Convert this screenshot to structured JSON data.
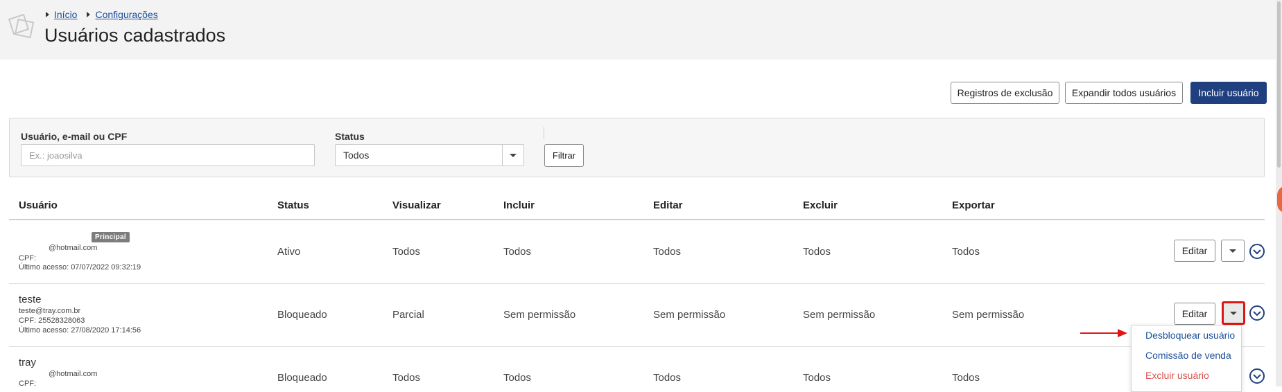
{
  "breadcrumb": {
    "items": [
      "Início",
      "Configurações"
    ]
  },
  "page": {
    "title": "Usuários cadastrados"
  },
  "toolbar": {
    "deletion_logs": "Registros de exclusão",
    "expand_all": "Expandir todos usuários",
    "add_user": "Incluir usuário"
  },
  "filters": {
    "user_label": "Usuário, e-mail ou CPF",
    "user_placeholder": "Ex.: joaosilva",
    "status_label": "Status",
    "status_value": "Todos",
    "filter_button": "Filtrar"
  },
  "table": {
    "headers": [
      "Usuário",
      "Status",
      "Visualizar",
      "Incluir",
      "Editar",
      "Excluir",
      "Exportar"
    ],
    "rows": [
      {
        "badge": "Principal",
        "email": "@hotmail.com",
        "cpf": "CPF:",
        "last_access": "Último acesso: 07/07/2022 09:32:19",
        "status": "Ativo",
        "view": "Todos",
        "include": "Todos",
        "edit": "Todos",
        "delete": "Todos",
        "export": "Todos"
      },
      {
        "name": "teste",
        "email": "teste@tray.com.br",
        "cpf": "CPF: 25528328063",
        "last_access": "Último acesso: 27/08/2020 17:14:56",
        "status": "Bloqueado",
        "view": "Parcial",
        "include": "Sem permissão",
        "edit": "Sem permissão",
        "delete": "Sem permissão",
        "export": "Sem permissão"
      },
      {
        "name": "tray",
        "email": "@hotmail.com",
        "cpf": "CPF:",
        "status": "Bloqueado",
        "view": "Todos",
        "include": "Todos",
        "edit": "Todos",
        "delete": "Todos",
        "export": "Todos"
      }
    ],
    "edit_label": "Editar"
  },
  "row_menu": {
    "items": [
      "Desbloquear usuário",
      "Comissão de venda",
      "Excluir usuário"
    ],
    "colors": {
      "action": "#1b4f9c",
      "danger": "#d9534f"
    }
  },
  "colors": {
    "primary": "#1f3f7e",
    "highlight": "#e01515",
    "accent": "#e8693f"
  }
}
